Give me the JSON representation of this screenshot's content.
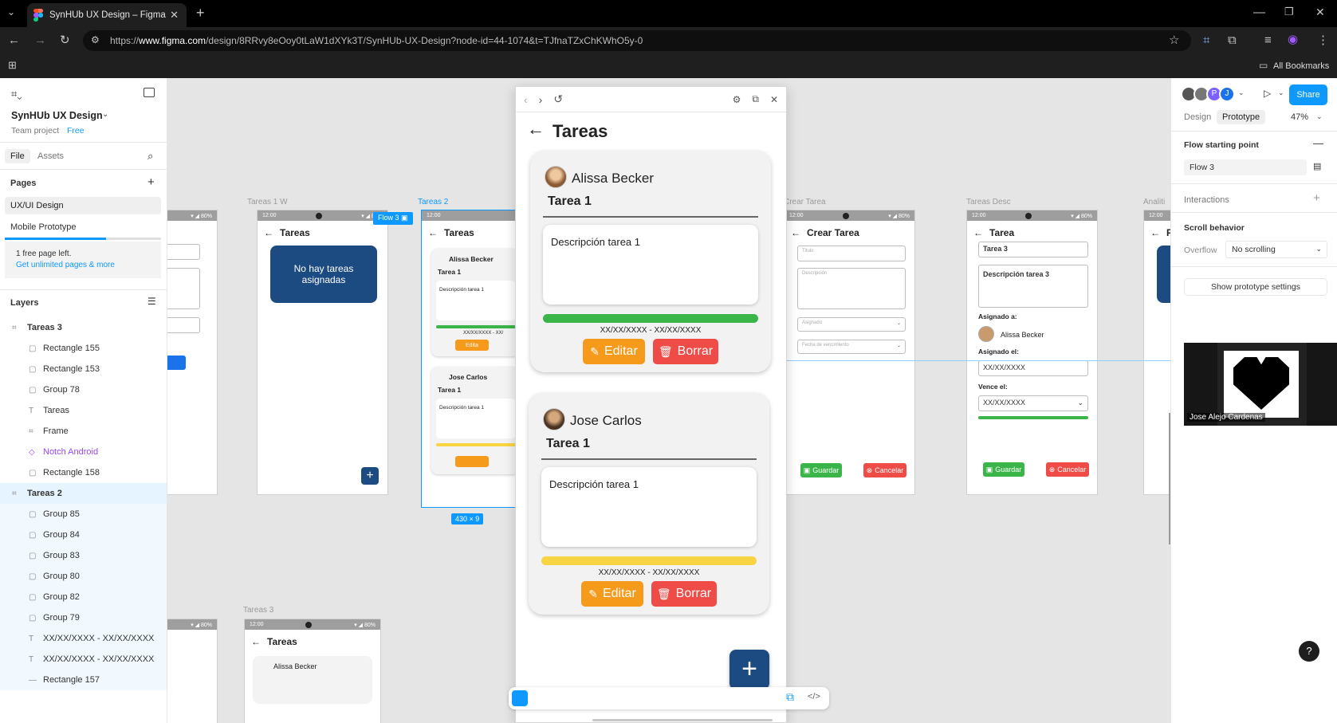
{
  "browser": {
    "tab_title": "SynHUb UX Design – Figma",
    "url_prefix": "https://",
    "url_host": "www.figma.com",
    "url_path": "/design/8RRvy8eOoy0tLaW1dXYk3T/SynHUb-UX-Design?node-id=44-1074&t=TJfnaTZxChKWhO5y-0",
    "bookmarks_label": "All Bookmarks"
  },
  "left_panel": {
    "file_name": "SynHUb UX Design",
    "team": "Team project",
    "plan": "Free",
    "tabs": [
      "File",
      "Assets"
    ],
    "pages_title": "Pages",
    "pages": [
      "UX/UI Design",
      "Mobile Prototype"
    ],
    "upsell_line1": "1 free page left.",
    "upsell_link": "Get unlimited pages & more",
    "layers_title": "Layers",
    "layers": [
      {
        "label": "Tareas 3",
        "icon": "frame",
        "indent": 0
      },
      {
        "label": "Rectangle 155",
        "icon": "rect",
        "indent": 1
      },
      {
        "label": "Rectangle 153",
        "icon": "rect",
        "indent": 1
      },
      {
        "label": "Group 78",
        "icon": "rect",
        "indent": 1
      },
      {
        "label": "Tareas",
        "icon": "text",
        "indent": 1
      },
      {
        "label": "Frame",
        "icon": "frame",
        "indent": 1
      },
      {
        "label": "Notch Android",
        "icon": "component",
        "indent": 1
      },
      {
        "label": "Rectangle 158",
        "icon": "rect",
        "indent": 1
      },
      {
        "label": "Tareas 2",
        "icon": "frame",
        "indent": 0
      },
      {
        "label": "Group 85",
        "icon": "rect",
        "indent": 1
      },
      {
        "label": "Group 84",
        "icon": "rect",
        "indent": 1
      },
      {
        "label": "Group 83",
        "icon": "rect",
        "indent": 1
      },
      {
        "label": "Group 80",
        "icon": "rect",
        "indent": 1
      },
      {
        "label": "Group 82",
        "icon": "rect",
        "indent": 1
      },
      {
        "label": "Group 79",
        "icon": "rect",
        "indent": 1
      },
      {
        "label": "XX/XX/XXXX - XX/XX/XXXX",
        "icon": "text",
        "indent": 1
      },
      {
        "label": "XX/XX/XXXX - XX/XX/XXXX",
        "icon": "text",
        "indent": 1
      },
      {
        "label": "Rectangle 157",
        "icon": "line",
        "indent": 1
      }
    ]
  },
  "canvas": {
    "frame_labels": [
      "Tareas 1 W",
      "Tareas 2",
      "Crear Tarea",
      "Tareas Desc",
      "Analiti",
      "Tareas 3"
    ],
    "flow_badge": "Flow 3",
    "size_badge": "430 × 9",
    "status_time": "12:00",
    "status_right": "▾ ◢ 80%",
    "t1_title": "Tareas",
    "t1_empty": "No hay tareas asignadas",
    "t2_title": "Tareas",
    "t2_user1": "Alissa Becker",
    "t2_task": "Tarea 1",
    "t2_desc": "Descripción tarea 1",
    "t2_dates": "XX/XX/XXXX - XX/",
    "t2_edit": "Edita",
    "t2_user2": "Jose Carlos",
    "crear_title": "Crear Tarea",
    "crear_fields": [
      "Titulo",
      "Descripción",
      "Asignado",
      "Fecha de vencimiento"
    ],
    "save": "Guardar",
    "cancel": "Cancelar",
    "desc_title": "Tarea",
    "desc_task": "Tarea 3",
    "desc_desc": "Descripción tarea 3",
    "assigned_to": "Asignado a:",
    "assigned_user": "Alissa Becker",
    "assigned_on": "Asignado el:",
    "assigned_date": "XX/XX/XXXX",
    "due": "Vence el:",
    "due_date": "XX/XX/XXXX",
    "analytics_title": "R",
    "t3_title": "Tareas",
    "t3_user": "Alissa Becker"
  },
  "prototype": {
    "screen_title": "Tareas",
    "cards": [
      {
        "user": "Alissa Becker",
        "task": "Tarea 1",
        "desc": "Descripción tarea 1",
        "progress_color": "#3bb54a",
        "dates": "XX/XX/XXXX - XX/XX/XXXX"
      },
      {
        "user": "Jose Carlos",
        "task": "Tarea 1",
        "desc": "Descripción tarea 1",
        "progress_color": "#f9d443",
        "dates": "XX/XX/XXXX - XX/XX/XXXX"
      }
    ],
    "edit_label": "Editar",
    "delete_label": "Borrar",
    "fab": "+"
  },
  "right_panel": {
    "tabs": [
      "Design",
      "Prototype"
    ],
    "zoom": "47%",
    "share": "Share",
    "avatars": [
      "P",
      "J"
    ],
    "flow_start_title": "Flow starting point",
    "flow_name": "Flow 3",
    "interactions": "Interactions",
    "scroll_behavior": "Scroll behavior",
    "overflow_label": "Overflow",
    "overflow_value": "No scrolling",
    "show_settings": "Show prototype settings",
    "video_name": "Jose Alejo Cardenas"
  },
  "colors": {
    "figma_blue": "#0d99ff",
    "navy": "#1c4b82",
    "orange": "#f59a1b",
    "red": "#ef4b47",
    "green": "#3bb54a",
    "yellow": "#f9d443"
  }
}
